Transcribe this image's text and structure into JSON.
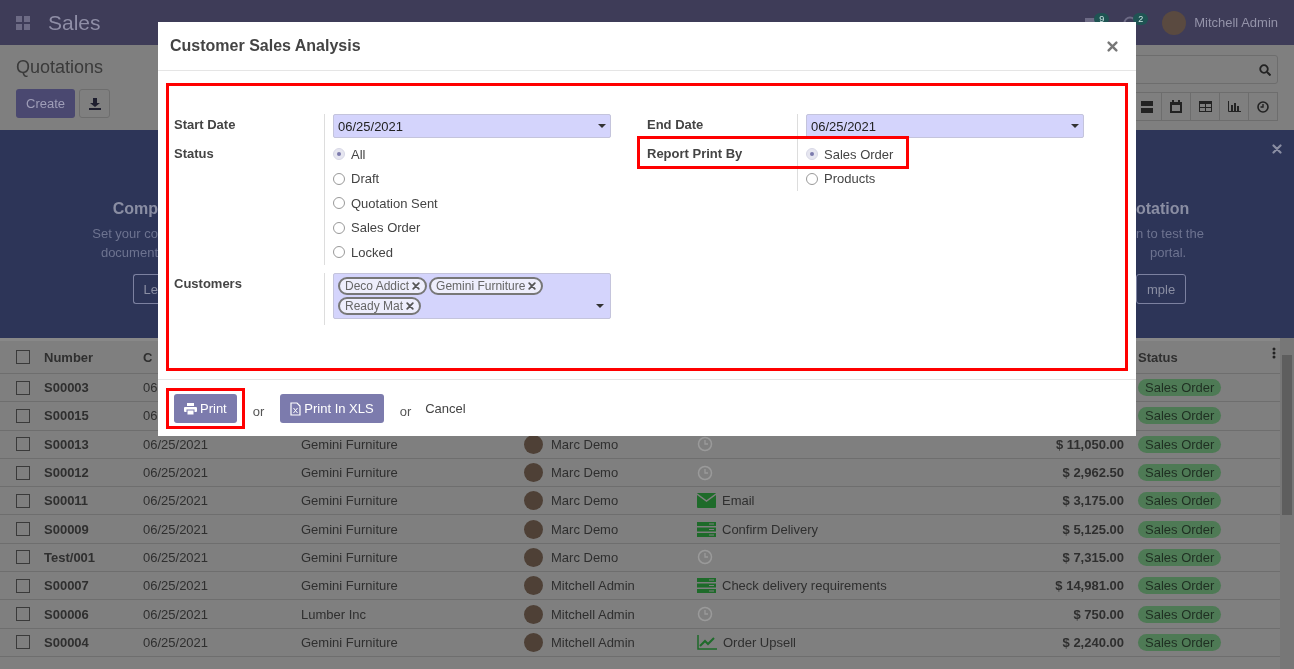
{
  "navbar": {
    "app_name": "Sales",
    "messages_count": "9",
    "activities_count": "2",
    "user": "Mitchell Admin"
  },
  "control_panel": {
    "title": "Quotations",
    "create_label": "Create"
  },
  "banner": {
    "left_heading": "Comp",
    "left_lines": [
      "Set your co",
      "document"
    ],
    "left_button": "Le",
    "right_heading": "otation",
    "right_lines": [
      "n to test the",
      "portal."
    ],
    "right_button": "mple"
  },
  "table": {
    "columns": [
      "Number",
      "C",
      "Status"
    ],
    "all_checked": false,
    "rows": [
      {
        "checked": false,
        "number": "S00003",
        "date": "06",
        "status": {
          "label": "Sales Order",
          "color": "#4e7a55"
        }
      },
      {
        "checked": false,
        "number": "S00015",
        "date": "06",
        "status": {
          "label": "Sales Order",
          "color": "#4e7a55"
        }
      },
      {
        "checked": false,
        "number": "S00013",
        "date": "06/25/2021",
        "customer": "Gemini Furniture",
        "salesperson": "Marc Demo",
        "activity": {
          "kind": "none"
        },
        "total": "$ 11,050.00",
        "status": {
          "label": "Sales Order",
          "color": "#4e7a55"
        }
      },
      {
        "checked": false,
        "number": "S00012",
        "date": "06/25/2021",
        "customer": "Gemini Furniture",
        "salesperson": "Marc Demo",
        "activity": {
          "kind": "none"
        },
        "total": "$ 2,962.50",
        "status": {
          "label": "Sales Order",
          "color": "#4e7a55"
        }
      },
      {
        "checked": false,
        "number": "S00011",
        "date": "06/25/2021",
        "customer": "Gemini Furniture",
        "salesperson": "Marc Demo",
        "activity": {
          "kind": "email",
          "label": "Email",
          "color": "#1e6b2a"
        },
        "total": "$ 3,175.00",
        "status": {
          "label": "Sales Order",
          "color": "#4e7a55"
        }
      },
      {
        "checked": false,
        "number": "S00009",
        "date": "06/25/2021",
        "customer": "Gemini Furniture",
        "salesperson": "Marc Demo",
        "activity": {
          "kind": "delivery",
          "label": "Confirm Delivery",
          "color": "#1e6b2a"
        },
        "total": "$ 5,125.00",
        "status": {
          "label": "Sales Order",
          "color": "#4e7a55"
        }
      },
      {
        "checked": false,
        "number": "Test/001",
        "date": "06/25/2021",
        "customer": "Gemini Furniture",
        "salesperson": "Marc Demo",
        "activity": {
          "kind": "none"
        },
        "total": "$ 7,315.00",
        "status": {
          "label": "Sales Order",
          "color": "#4e7a55"
        }
      },
      {
        "checked": false,
        "number": "S00007",
        "date": "06/25/2021",
        "customer": "Gemini Furniture",
        "salesperson": "Mitchell Admin",
        "activity": {
          "kind": "delivery",
          "label": "Check delivery requirements",
          "color": "#1e6b2a"
        },
        "total": "$ 14,981.00",
        "status": {
          "label": "Sales Order",
          "color": "#4e7a55"
        }
      },
      {
        "checked": false,
        "number": "S00006",
        "date": "06/25/2021",
        "customer": "Lumber Inc",
        "salesperson": "Mitchell Admin",
        "activity": {
          "kind": "none"
        },
        "total": "$ 750.00",
        "status": {
          "label": "Sales Order",
          "color": "#4e7a55"
        }
      },
      {
        "checked": false,
        "number": "S00004",
        "date": "06/25/2021",
        "customer": "Gemini Furniture",
        "salesperson": "Mitchell Admin",
        "activity": {
          "kind": "upsell",
          "label": "Order Upsell",
          "color": "#1e6b2a"
        },
        "total": "$ 2,240.00",
        "status": {
          "label": "Sales Order",
          "color": "#4e7a55"
        }
      }
    ]
  },
  "dialog": {
    "title": "Customer Sales Analysis",
    "form_highlighted": true,
    "start_date": {
      "label": "Start Date",
      "value": "06/25/2021"
    },
    "end_date": {
      "label": "End Date",
      "value": "06/25/2021"
    },
    "status": {
      "label": "Status",
      "options": [
        {
          "label": "All",
          "selected": true
        },
        {
          "label": "Draft",
          "selected": false
        },
        {
          "label": "Quotation Sent",
          "selected": false
        },
        {
          "label": "Sales Order",
          "selected": false
        },
        {
          "label": "Locked",
          "selected": false
        }
      ]
    },
    "report_print_by": {
      "label": "Report Print By",
      "highlighted": true,
      "options": [
        {
          "label": "Sales Order",
          "selected": true
        },
        {
          "label": "Products",
          "selected": false
        }
      ]
    },
    "customers": {
      "label": "Customers",
      "tags": [
        "Deco Addict",
        "Gemini Furniture",
        "Ready Mat"
      ]
    },
    "footer": [
      {
        "kind": "print_button",
        "label": "Print",
        "highlighted": true
      },
      {
        "kind": "text",
        "label": "or"
      },
      {
        "kind": "xls_button",
        "label": "Print In XLS",
        "highlighted": false
      },
      {
        "kind": "text",
        "label": "or"
      },
      {
        "kind": "link",
        "label": "Cancel"
      }
    ]
  }
}
